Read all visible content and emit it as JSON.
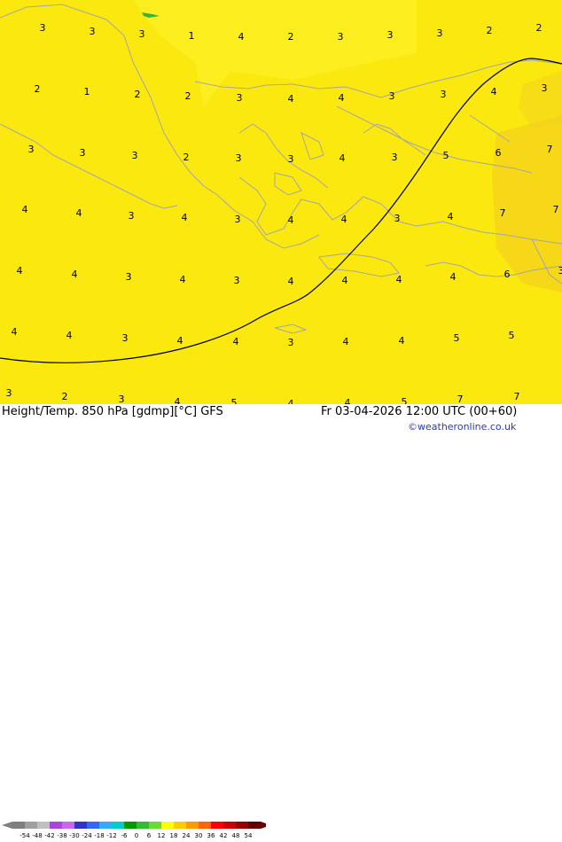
{
  "title": "Height/Temp. 850 hPa [gdmp][°C] GFS",
  "run_time": "Fr 03-04-2026 12:00 UTC (00+60)",
  "credit": "©weatheronline.co.uk",
  "colorbar": {
    "ticks": [
      "-54",
      "-48",
      "-42",
      "-38",
      "-30",
      "-24",
      "-18",
      "-12",
      "-6",
      "0",
      "6",
      "12",
      "18",
      "24",
      "30",
      "36",
      "42",
      "48",
      "54"
    ],
    "colors": [
      "#7f7f7f",
      "#a0a0a0",
      "#c0c0c0",
      "#aa44dd",
      "#cc66ee",
      "#3333cc",
      "#3366ff",
      "#33aaff",
      "#00cccc",
      "#009900",
      "#33bb33",
      "#66dd33",
      "#ffff00",
      "#ffcc00",
      "#ff9900",
      "#ff6600",
      "#ff0000",
      "#cc0000",
      "#990000",
      "#660000"
    ]
  },
  "colors": {
    "field_main": "#fbe80f",
    "field_light": "#fff32a",
    "field_warm": "#f4d21e",
    "coast": "#a6a6a6",
    "contour": "#000000"
  },
  "temperature_labels": [
    [
      "3",
      48,
      35
    ],
    [
      "3",
      104,
      39
    ],
    [
      "3",
      160,
      42
    ],
    [
      "1",
      216,
      44
    ],
    [
      "4",
      272,
      45
    ],
    [
      "2",
      328,
      45
    ],
    [
      "3",
      384,
      45
    ],
    [
      "3",
      440,
      43
    ],
    [
      "3",
      496,
      41
    ],
    [
      "2",
      552,
      38
    ],
    [
      "2",
      608,
      35
    ],
    [
      "2",
      42,
      104
    ],
    [
      "1",
      98,
      107
    ],
    [
      "2",
      155,
      110
    ],
    [
      "2",
      212,
      112
    ],
    [
      "3",
      270,
      114
    ],
    [
      "4",
      328,
      115
    ],
    [
      "4",
      385,
      114
    ],
    [
      "3",
      442,
      112
    ],
    [
      "3",
      500,
      110
    ],
    [
      "4",
      557,
      107
    ],
    [
      "3",
      614,
      103
    ],
    [
      "3",
      35,
      172
    ],
    [
      "3",
      93,
      176
    ],
    [
      "3",
      152,
      179
    ],
    [
      "2",
      210,
      181
    ],
    [
      "3",
      269,
      182
    ],
    [
      "3",
      328,
      183
    ],
    [
      "4",
      386,
      182
    ],
    [
      "3",
      445,
      181
    ],
    [
      "5",
      503,
      179
    ],
    [
      "6",
      562,
      176
    ],
    [
      "7",
      620,
      172
    ],
    [
      "4",
      28,
      240
    ],
    [
      "4",
      89,
      244
    ],
    [
      "3",
      148,
      247
    ],
    [
      "4",
      208,
      249
    ],
    [
      "3",
      268,
      251
    ],
    [
      "4",
      328,
      252
    ],
    [
      "4",
      388,
      251
    ],
    [
      "3",
      448,
      250
    ],
    [
      "4",
      508,
      248
    ],
    [
      "7",
      567,
      244
    ],
    [
      "7",
      627,
      240
    ],
    [
      "4",
      22,
      309
    ],
    [
      "4",
      84,
      313
    ],
    [
      "3",
      145,
      316
    ],
    [
      "4",
      206,
      319
    ],
    [
      "3",
      267,
      320
    ],
    [
      "4",
      328,
      321
    ],
    [
      "4",
      389,
      320
    ],
    [
      "4",
      450,
      319
    ],
    [
      "4",
      511,
      316
    ],
    [
      "6",
      572,
      313
    ],
    [
      "3",
      633,
      309
    ],
    [
      "4",
      16,
      378
    ],
    [
      "4",
      78,
      382
    ],
    [
      "3",
      141,
      385
    ],
    [
      "4",
      203,
      388
    ],
    [
      "4",
      266,
      389
    ],
    [
      "3",
      328,
      390
    ],
    [
      "4",
      390,
      389
    ],
    [
      "4",
      453,
      388
    ],
    [
      "5",
      515,
      385
    ],
    [
      "5",
      577,
      382
    ],
    [
      "3",
      10,
      447
    ],
    [
      "2",
      73,
      451
    ],
    [
      "3",
      137,
      454
    ],
    [
      "4",
      200,
      457
    ],
    [
      "5",
      264,
      458
    ],
    [
      "4",
      328,
      459
    ],
    [
      "4",
      392,
      458
    ],
    [
      "5",
      456,
      457
    ],
    [
      "7",
      519,
      454
    ],
    [
      "7",
      583,
      451
    ]
  ]
}
